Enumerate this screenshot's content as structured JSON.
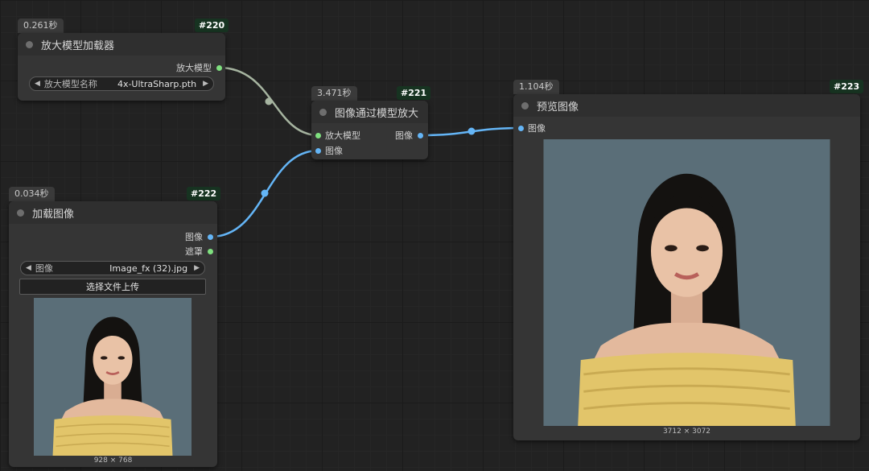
{
  "nodes": {
    "upscale_loader": {
      "id": "#220",
      "timing": "0.261秒",
      "title": "放大模型加载器",
      "output": "放大模型",
      "widget_label": "放大模型名称",
      "widget_value": "4x-UltraSharp.pth"
    },
    "upscale": {
      "id": "#221",
      "timing": "3.471秒",
      "title": "图像通过模型放大",
      "input_model": "放大模型",
      "input_image": "图像",
      "output_image": "图像"
    },
    "load_image": {
      "id": "#222",
      "timing": "0.034秒",
      "title": "加载图像",
      "output_image": "图像",
      "output_mask": "遮罩",
      "widget_label": "图像",
      "widget_value": "Image_fx (32).jpg",
      "upload_button": "选择文件上传",
      "image_size": "928 × 768"
    },
    "preview": {
      "id": "#223",
      "timing": "1.104秒",
      "title": "预览图像",
      "input_image": "图像",
      "image_size": "3712 × 3072"
    }
  },
  "colors": {
    "model_link": "#a6b4a0",
    "image_link": "#64b5f6",
    "model_slot": "#7fe07f",
    "image_slot": "#64b5f6"
  },
  "icons": [
    "arrow-left-icon",
    "arrow-right-icon",
    "node-dot-icon",
    "slot-dot-icon"
  ]
}
